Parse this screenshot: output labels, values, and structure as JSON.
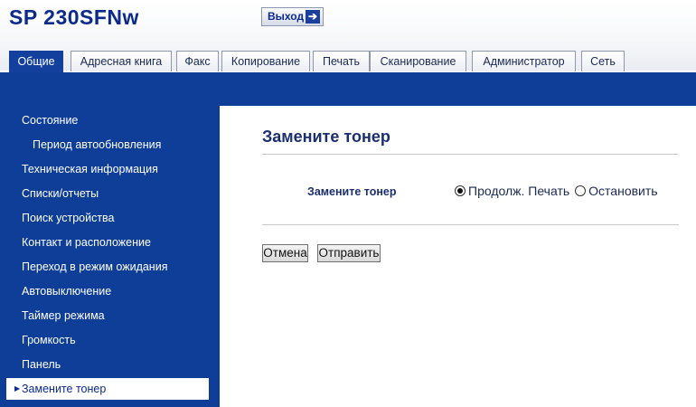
{
  "header": {
    "model": "SP 230SFNw",
    "logout_label": "Выход"
  },
  "tabs": [
    {
      "label": "Общие",
      "active": true
    },
    {
      "label": "Адресная книга"
    },
    {
      "label": "Факс"
    },
    {
      "label": "Копирование"
    },
    {
      "label": "Печать"
    },
    {
      "label": "Сканирование"
    },
    {
      "label": "Администратор"
    },
    {
      "label": "Сеть"
    }
  ],
  "sidebar": {
    "items": [
      {
        "label": "Состояние"
      },
      {
        "label": "Период автообновления"
      },
      {
        "label": "Техническая информация"
      },
      {
        "label": "Списки/отчеты"
      },
      {
        "label": "Поиск устройства"
      },
      {
        "label": "Контакт и расположение"
      },
      {
        "label": "Переход в режим ожидания"
      },
      {
        "label": "Автовыключение"
      },
      {
        "label": "Таймер режима"
      },
      {
        "label": "Громкость"
      },
      {
        "label": "Панель"
      },
      {
        "label": "Замените тонер",
        "selected": true
      }
    ]
  },
  "main": {
    "title": "Замените тонер",
    "field_label": "Замените тонер",
    "options": [
      {
        "label": "Продолж. Печать",
        "checked": true
      },
      {
        "label": "Остановить",
        "checked": false
      }
    ],
    "cancel_label": "Отмена",
    "submit_label": "Отправить"
  },
  "colors": {
    "brand_blue": "#0f3e99",
    "title_blue": "#1a2f70"
  }
}
